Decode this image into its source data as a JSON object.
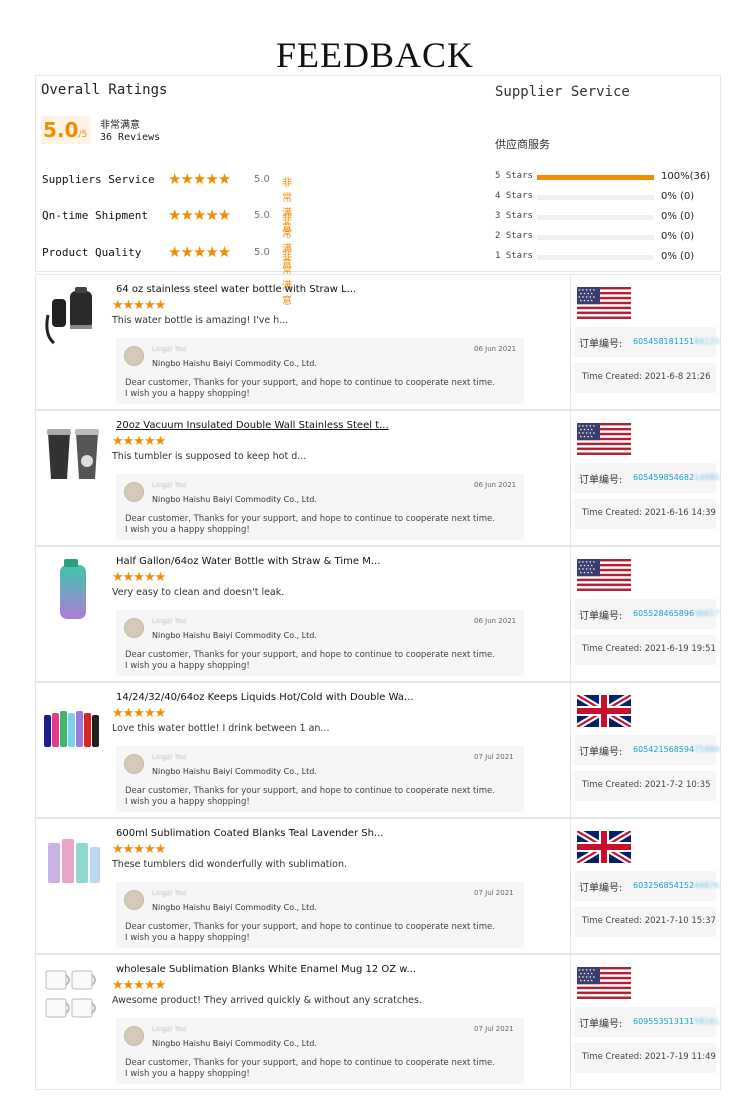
{
  "page_title": "FEEDBACK",
  "overall": {
    "title": "Overall Ratings",
    "score": "5.0",
    "score_out_of": "/5",
    "satisfaction": "非常满意",
    "reviews": "36 Reviews",
    "ratings": [
      {
        "label": "Suppliers Service",
        "stars": "★★★★★",
        "value": "5.0",
        "text": "非常满意"
      },
      {
        "label": "Qn-time Shipment",
        "stars": "★★★★★",
        "value": "5.0",
        "text": "非常满意"
      },
      {
        "label": "Product  Quality",
        "stars": "★★★★★",
        "value": "5.0",
        "text": "非常满意"
      }
    ]
  },
  "supplier": {
    "title": "Supplier Service",
    "subtitle": "供应商服务",
    "bars": [
      {
        "label": "5 Stars",
        "fraction": 1.0,
        "pct": "100%(36)"
      },
      {
        "label": "4 Stars",
        "fraction": 0.0,
        "pct": "0%  (0)"
      },
      {
        "label": "3 Stars",
        "fraction": 0.0,
        "pct": "0%  (0)"
      },
      {
        "label": "2 Stars",
        "fraction": 0.0,
        "pct": "0%  (0)"
      },
      {
        "label": "1 Stars",
        "fraction": 0.0,
        "pct": "0%  (0)"
      }
    ]
  },
  "reply_common": {
    "name": "Lingzi Yao",
    "company": "Ningbo Haishu Baiyi Commodity Co., Ltd.",
    "message_1": "Dear customer, Thanks for your support, and hope to continue to cooperate next time.",
    "message_2": "I wish you a happy shopping!"
  },
  "order_label": "订单编号:",
  "reviews": [
    {
      "product": "64 oz stainless steel water bottle with Straw L...",
      "stars": "★★★★★",
      "text": "This water bottle is amazing! I've h...",
      "reply_date": "06 Jun 2021",
      "flag": "us",
      "order_visible": "605458181151",
      "order_blurred": "84125",
      "time": "Time Created:   2021-6-8 21:26"
    },
    {
      "product": "20oz Vacuum Insulated Double Wall Stainless Steel t...",
      "stars": "★★★★★",
      "text": "This tumbler is supposed to keep hot d...",
      "reply_date": "06 Jun 2021",
      "flag": "us",
      "order_visible": "605459854682",
      "order_blurred": "14985",
      "time": "Time Created:   2021-6-16 14:39"
    },
    {
      "product": "Half Gallon/64oz Water Bottle with Straw & Time M...",
      "stars": "★★★★★",
      "text": "Very easy to clean and doesn't leak.",
      "reply_date": "06 Jun 2021",
      "flag": "us",
      "order_visible": "605528465896",
      "order_blurred": "36817",
      "time": "Time Created:   2021-6-19 19:51"
    },
    {
      "product": "14/24/32/40/64oz Keeps Liquids Hot/Cold with Double Wa...",
      "stars": "★★★★★",
      "text": "Love this water bottle! I drink between 1 an...",
      "reply_date": "07 Jul 2021",
      "flag": "uk",
      "order_visible": "605421568594",
      "order_blurred": "75984",
      "time": "Time Created:   2021-7-2 10:35"
    },
    {
      "product": "600ml Sublimation Coated Blanks Teal Lavender Sh...",
      "stars": "★★★★★",
      "text": "These tumblers did wonderfully with sublimation.",
      "reply_date": "07 Jul 2021",
      "flag": "uk",
      "order_visible": "603256854152",
      "order_blurred": "44876",
      "time": "Time Created:   2021-7-10 15:37"
    },
    {
      "product": "wholesale Sublimation Blanks White Enamel Mug 12 OZ w...",
      "stars": "★★★★★",
      "text": "Awesome product! They arrived quickly & without any scratches.",
      "reply_date": "07 Jul 2021",
      "flag": "us",
      "order_visible": "609553513131",
      "order_blurred": "58161",
      "time": "Time Created:   2021-7-19 11:49"
    }
  ]
}
